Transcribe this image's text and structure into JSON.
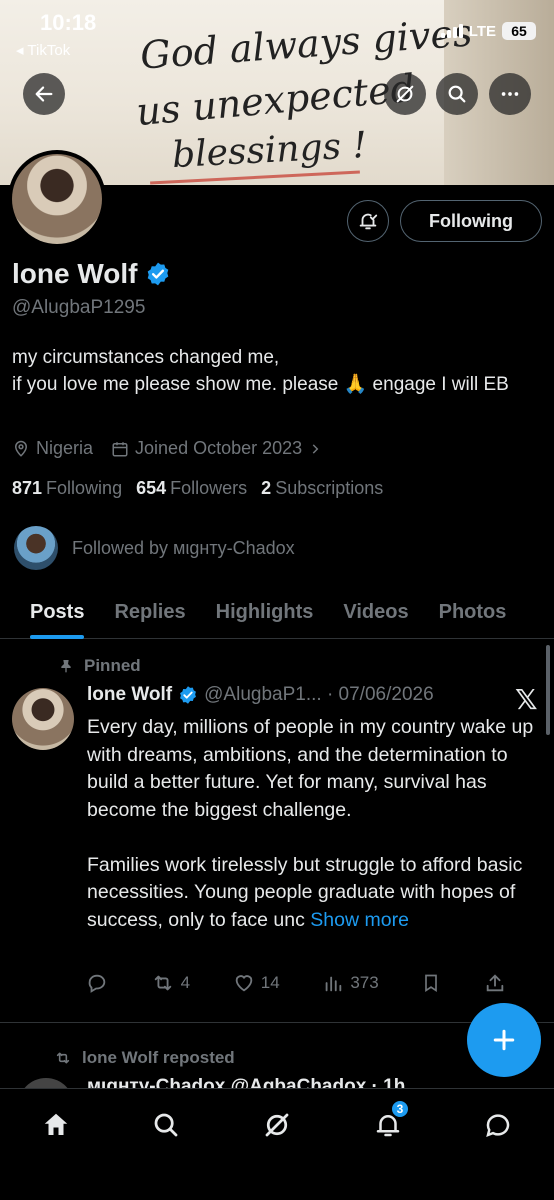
{
  "status_bar": {
    "time": "10:18",
    "back_app": "◂ TikTok",
    "network": "LTE",
    "battery": "65"
  },
  "banner": {
    "line1": "God always gives",
    "line2": "us unexpected",
    "line3": "blessings !"
  },
  "profile": {
    "following_button": "Following",
    "name": "lone Wolf",
    "handle": "@AlugbaP1295",
    "bio_line1": "my circumstances changed me,",
    "bio_line2": "if you love me please show me. please 🙏 engage I will EB",
    "location": "Nigeria",
    "joined": "Joined October 2023",
    "following_count": "871",
    "following_label": "Following",
    "followers_count": "654",
    "followers_label": "Followers",
    "subscriptions_count": "2",
    "subscriptions_label": "Subscriptions",
    "followed_by": "Followed by мιgнтy-Chadox"
  },
  "tabs": [
    "Posts",
    "Replies",
    "Highlights",
    "Videos",
    "Photos"
  ],
  "pinned_tweet": {
    "pinned_label": "Pinned",
    "name": "lone Wolf",
    "handle_date": "@AlugbaP1... · 07/06/2026",
    "text_p1": "Every day, millions of people in my country wake up with dreams, ambitions, and the determination to build a better future. Yet for many, survival has become the biggest challenge.",
    "text_p2": "Families work tirelessly but struggle to afford basic necessities. Young people graduate with hopes of success, only to face unc",
    "show_more": "Show more",
    "retweets": "4",
    "likes": "14",
    "views": "373"
  },
  "next_post": {
    "repost_label": "lone Wolf reposted",
    "peek_text": "мιgнтy-Chadox  @AgbaChadox · 1h"
  },
  "notifications_badge": "3",
  "colors": {
    "accent": "#1d9bf0",
    "muted": "#71767b",
    "text": "#e7e9ea",
    "background": "#000000"
  }
}
